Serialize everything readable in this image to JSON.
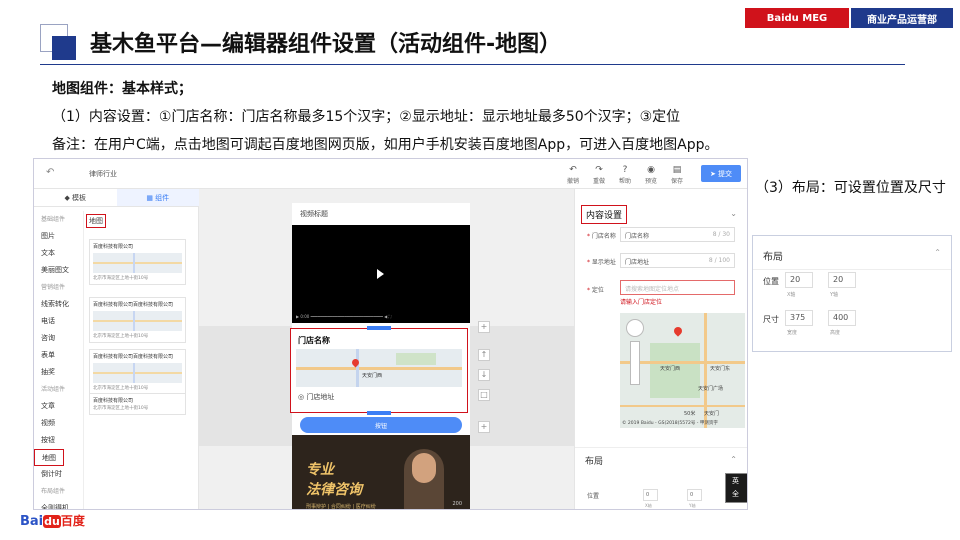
{
  "header": {
    "badge_left": "Baidu MEG",
    "badge_right": "商业产品运营部"
  },
  "title": "基木鱼平台—编辑器组件设置（活动组件-地图）",
  "intro": {
    "line1": "地图组件：基本样式；",
    "line2": "（1）内容设置：①门店名称：门店名称最多15个汉字；②显示地址：显示地址最多50个汉字；③定位",
    "line3": "备注：在用户C端，点击地图可调起百度地图网页版，如用户手机安装百度地图App，可进入百度地图App。"
  },
  "editor": {
    "search_value": "律师行业",
    "toolbar": [
      {
        "icon": "↶",
        "label": "撤销"
      },
      {
        "icon": "↷",
        "label": "重做"
      },
      {
        "icon": "?",
        "label": "帮助"
      },
      {
        "icon": "◉",
        "label": "预览"
      },
      {
        "icon": "▤",
        "label": "保存"
      }
    ],
    "publish": "提交",
    "left_tabs": [
      "模板",
      "组件"
    ],
    "categories": [
      "基础组件",
      "图片",
      "文本",
      "美丽图文",
      "营销组件",
      "线索转化",
      "电话",
      "咨询",
      "表单",
      "抽奖",
      "活动组件",
      "文章",
      "视频",
      "按钮",
      "地图",
      "倒计时",
      "布局组件",
      "全则得机"
    ],
    "component_header": "地图",
    "cards": [
      {
        "title": "百度科技有限公司",
        "address": "北京市海淀区上地十街10号"
      },
      {
        "title": "百度科技有限公司百度科技有限公司",
        "address": "北京市海淀区上地十街10号"
      },
      {
        "title": "百度科技有限公司百度科技有限公司",
        "address": "北京市海淀区上地十街10号"
      },
      {
        "title": "百度科技有限公司",
        "address": "北京市海淀区上地十街10号"
      }
    ],
    "phone": {
      "video_title": "视频标题",
      "store_name": "门店名称",
      "map_label": "天安门西",
      "store_address": "门店地址",
      "button_label": "按钮",
      "ad_line1": "专业",
      "ad_line2": "法律咨询",
      "ad_sub": "刑事辩护 | 合同纠纷 | 医疗纠纷",
      "ad_num": "200"
    },
    "side_tools": [
      "+",
      "↑",
      "↓",
      "□",
      "+"
    ],
    "right": {
      "section_content": "内容设置",
      "store_name_label": "门店名称",
      "store_name_value": "门店名称",
      "store_name_count": "8 / 30",
      "address_label": "显示地址",
      "address_value": "门店地址",
      "address_count": "8 / 100",
      "location_label": "定位",
      "location_placeholder": "请搜索地图定位地点",
      "location_error": "请输入门店定位",
      "map_copyright": "© 2019 Baidu - GS(2018)5572号 - 甲测资字",
      "map_labels": [
        "天安门西",
        "天安门东",
        "天安门广场",
        "天安门"
      ],
      "map_scale": "50米",
      "section_layout": "布局",
      "position_label": "位置",
      "pos_values": [
        "0",
        "0"
      ],
      "pos_subs": [
        "X轴",
        "Y轴"
      ]
    },
    "ime": {
      "a": "英",
      "b": "简",
      "c": "全"
    }
  },
  "note3": "（3）布局：可设置位置及尺寸",
  "layout_panel": {
    "title": "布局",
    "position_label": "位置",
    "pos_x": "20",
    "pos_y": "20",
    "pos_x_sub": "X轴",
    "pos_y_sub": "Y轴",
    "size_label": "尺寸",
    "width": "375",
    "height": "400",
    "width_sub": "宽度",
    "height_sub": "高度"
  },
  "logo": {
    "part1": "Bai",
    "part2": "du",
    "part3": "百度"
  }
}
